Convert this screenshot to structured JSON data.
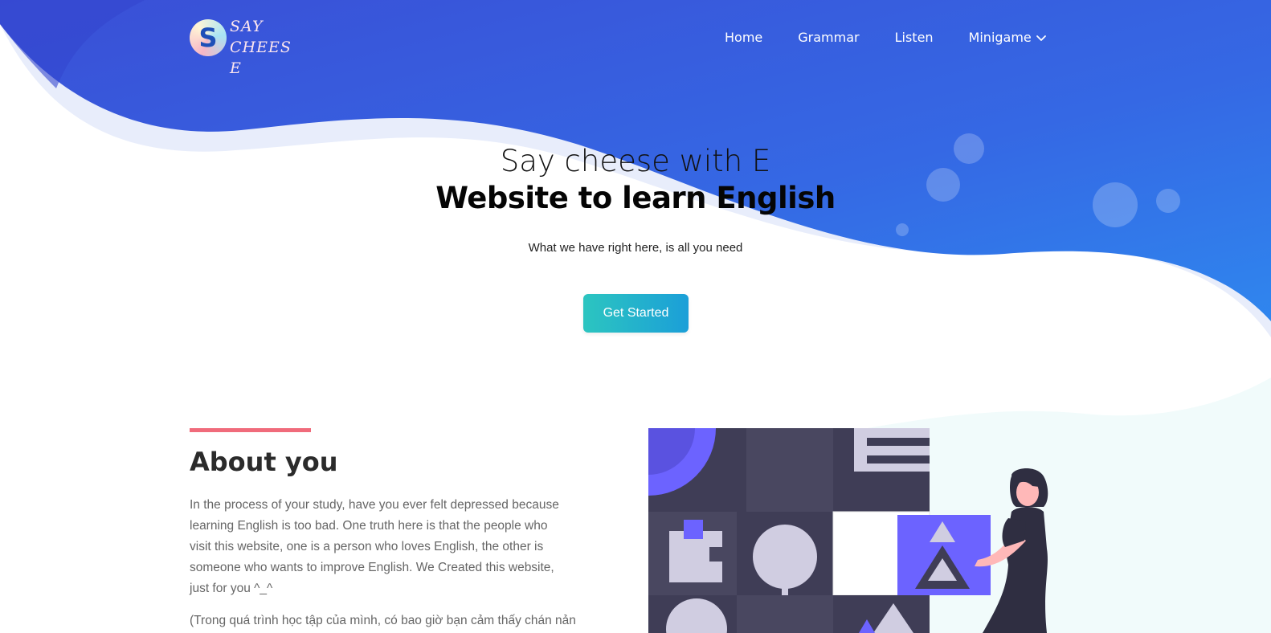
{
  "brand": {
    "logo_letter": "S",
    "logo_line1": "SAY",
    "logo_line2": "CHEES E"
  },
  "nav": {
    "items": [
      {
        "label": "Home"
      },
      {
        "label": "Grammar"
      },
      {
        "label": "Listen"
      },
      {
        "label": "Minigame"
      }
    ]
  },
  "hero": {
    "title_line1": "Say cheese with E",
    "title_line2": "Website to learn English",
    "subtitle": "What we have right here, is all you need",
    "cta_label": "Get Started"
  },
  "about": {
    "title": "About you",
    "paragraph1": "In the process of your study, have you ever felt depressed because learning English is too bad. One truth here is that the people who visit this website, one is a person who loves English, the other is someone who wants to improve English. We Created this website, just for you ^_^",
    "paragraph2": "(Trong quá trình học tập của mình, có bao giờ bạn cảm thấy chán nản"
  },
  "colors": {
    "hero_blue_start": "#3a52d8",
    "hero_blue_end": "#2f80ed",
    "cta_start": "#2cc5c0",
    "cta_end": "#1b9fd8",
    "accent_bar": "#f06b7b",
    "illustration_purple": "#6c63ff",
    "illustration_dark": "#3f3d56"
  }
}
